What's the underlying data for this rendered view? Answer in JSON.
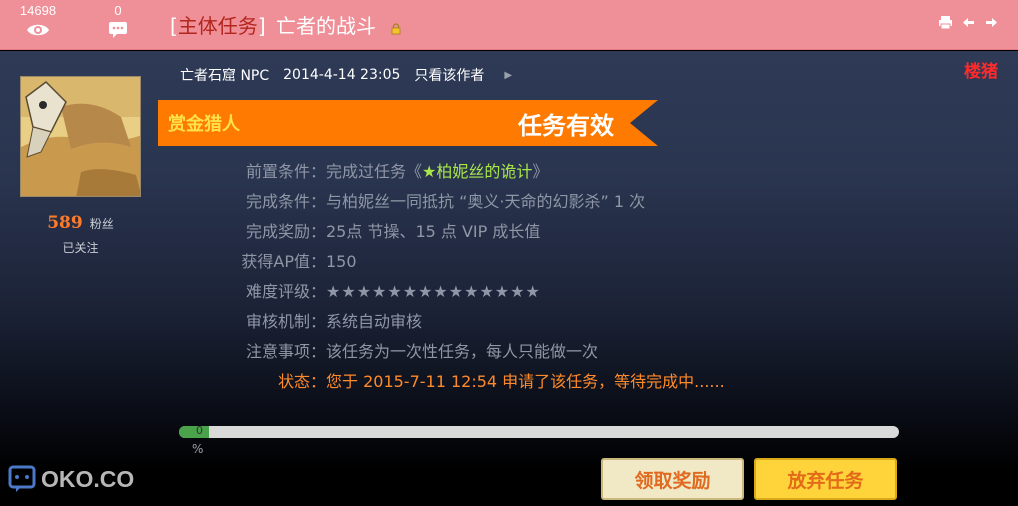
{
  "header": {
    "views_count": "14698",
    "comments_count": "0",
    "tag_open": "[",
    "tag_label": "主体任务",
    "tag_close": "]",
    "title": "亡者的战斗",
    "icons": [
      "eye-icon",
      "comment-icon",
      "lock-icon",
      "print-icon",
      "prev-icon",
      "next-icon"
    ]
  },
  "author": {
    "fans_count": "589",
    "fans_label": "粉丝",
    "followed_label": "已关注"
  },
  "post_meta": {
    "author_name": "亡者石窟 NPC",
    "datetime": "2014-4-14 23:05",
    "only_author": "只看该作者",
    "floor_label": "楼猪"
  },
  "banner": {
    "left_label": "赏金猎人",
    "right_label": "任务有效",
    "color": "#ff7a00"
  },
  "task_details": [
    {
      "key": "前置条件：",
      "value_prefix": "完成过任务《",
      "value_link": "★柏妮丝的诡计",
      "value_suffix": "》"
    },
    {
      "key": "完成条件：",
      "value": "与柏妮丝一同抵抗 “奥义·天命的幻影杀” 1 次"
    },
    {
      "key": "完成奖励：",
      "value": "25点 节操、15 点 VIP 成长值"
    },
    {
      "key": "获得AP值：",
      "value": "150"
    },
    {
      "key": "难度评级：",
      "value": "★★★★★★★★★★★★★★"
    },
    {
      "key": "审核机制：",
      "value": "系统自动审核"
    },
    {
      "key": "注意事项：",
      "value": "该任务为一次性任务，每人只能做一次"
    },
    {
      "key": "状态：",
      "value": "您于 2015-7-11 12:54 申请了该任务，等待完成中......"
    }
  ],
  "progress": {
    "value_text": "0",
    "fraction": 0.0,
    "percent_sign": "%"
  },
  "buttons": {
    "claim_label": "领取奖励",
    "abandon_label": "放弃任务"
  },
  "watermark": {
    "text": "OKO.CO"
  }
}
